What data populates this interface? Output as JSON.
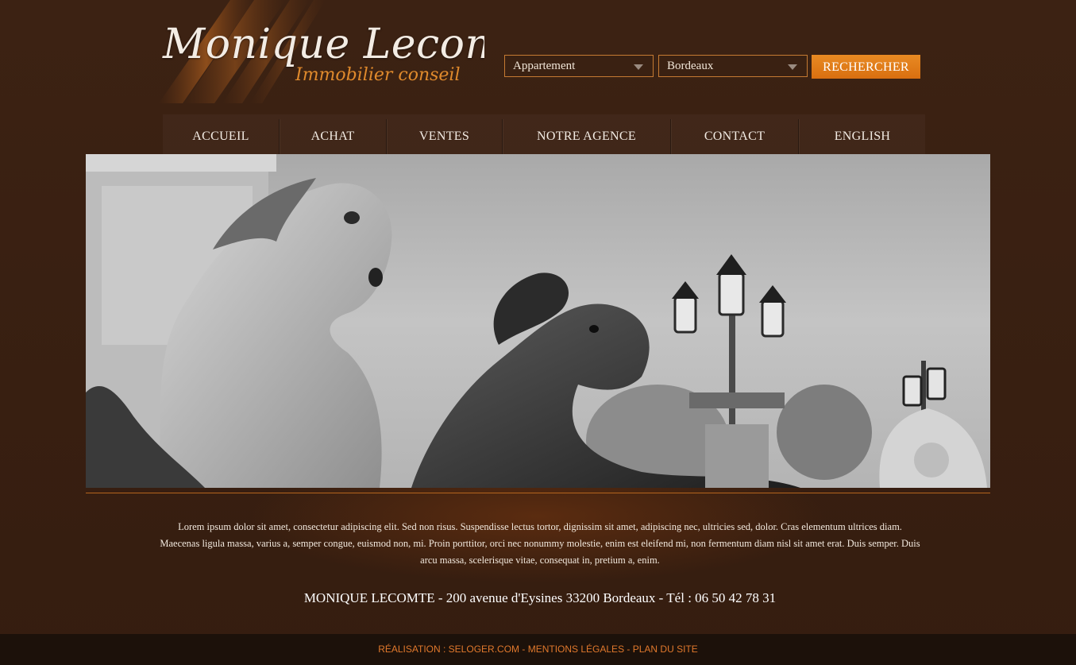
{
  "brand": {
    "name": "Monique Lecomte",
    "tagline": "Immobilier conseil"
  },
  "search": {
    "type_value": "Appartement",
    "city_value": "Bordeaux",
    "button_label": "RECHERCHER"
  },
  "nav": {
    "items": [
      {
        "label": "ACCUEIL"
      },
      {
        "label": "ACHAT"
      },
      {
        "label": "VENTES"
      },
      {
        "label": "NOTRE AGENCE"
      },
      {
        "label": "CONTACT"
      },
      {
        "label": "ENGLISH"
      }
    ]
  },
  "main": {
    "intro": "Lorem ipsum dolor sit amet, consectetur adipiscing elit. Sed non risus. Suspendisse lectus tortor, dignissim sit amet, adipiscing nec, ultricies sed, dolor. Cras elementum ultrices diam. Maecenas ligula massa, varius a, semper congue, euismod non, mi. Proin porttitor, orci nec nonummy molestie, enim est eleifend mi, non fermentum diam nisl sit amet erat. Duis semper. Duis arcu massa, scelerisque vitae, consequat in, pretium a, enim.",
    "address": "MONIQUE LECOMTE - 200 avenue d'Eysines 33200 Bordeaux - Tél : 06 50 42 78 31"
  },
  "footer": {
    "realisation_prefix": "RÉALISATION : ",
    "realisation_link": "SELOGER.COM",
    "separator": " - ",
    "legal": "MENTIONS LÉGALES",
    "sitemap": "PLAN DU SITE"
  },
  "colors": {
    "accent": "#e0782c",
    "background": "#3b2112"
  }
}
